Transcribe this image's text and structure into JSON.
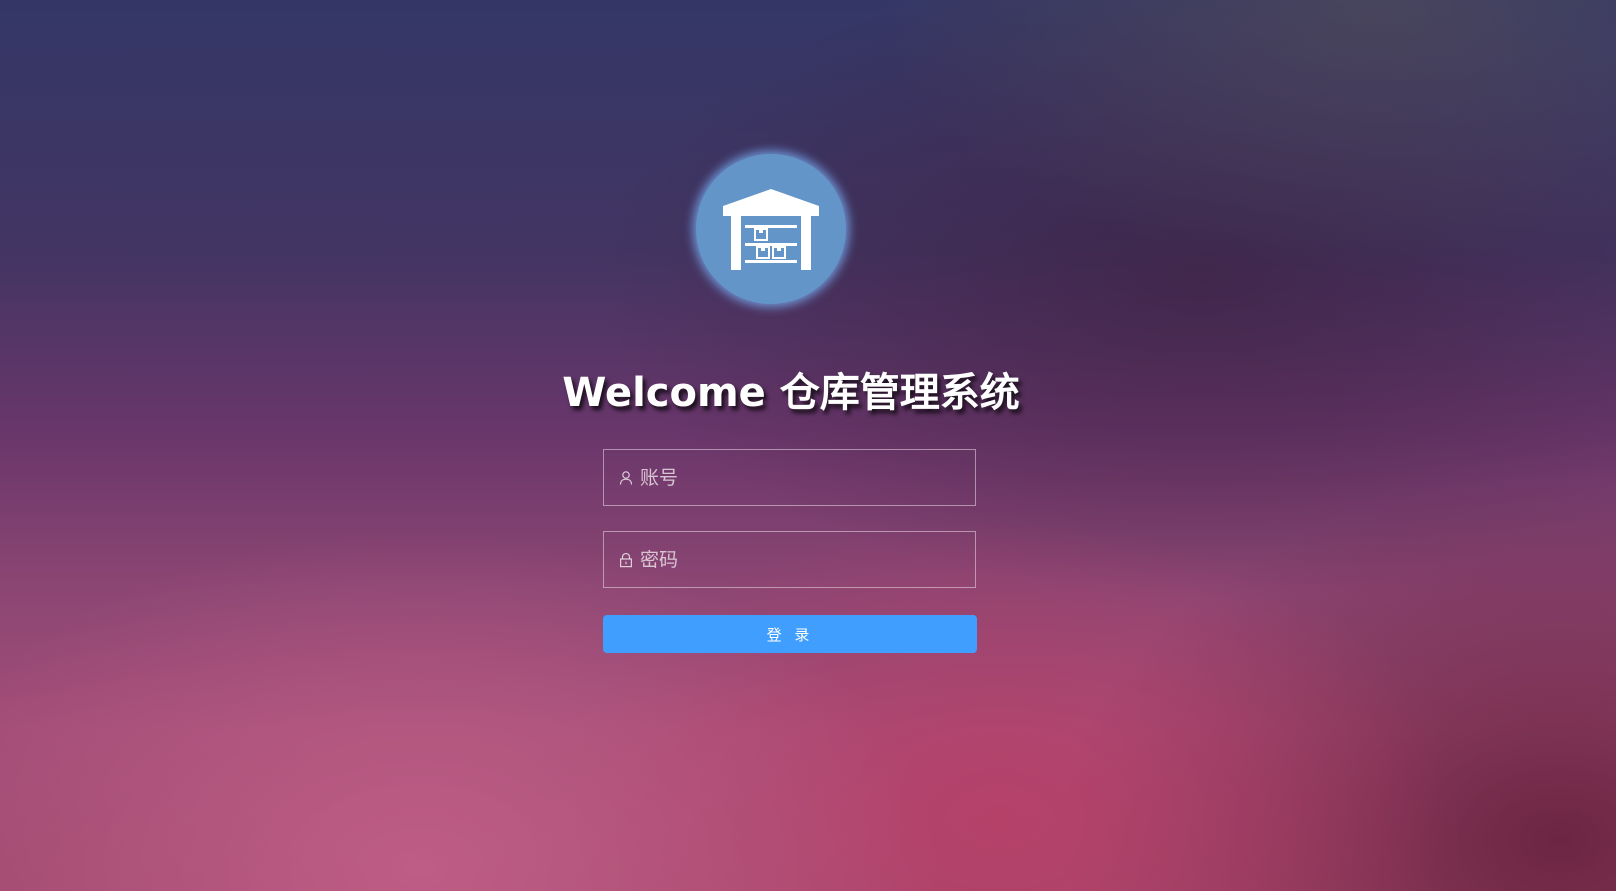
{
  "logo": {
    "icon": "warehouse-icon",
    "background": "#6495c8"
  },
  "title": "Welcome 仓库管理系统",
  "form": {
    "account": {
      "icon": "user-icon",
      "placeholder": "账号",
      "value": ""
    },
    "password": {
      "icon": "lock-icon",
      "placeholder": "密码",
      "value": ""
    },
    "login_label": "登 录",
    "login_color": "#409eff"
  }
}
